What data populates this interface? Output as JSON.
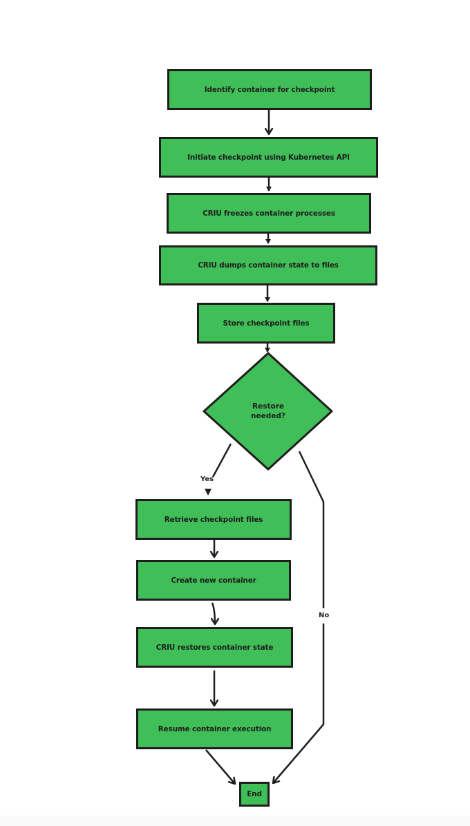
{
  "diagram": {
    "type": "flowchart",
    "fill_color": "#40bf59",
    "stroke_color": "#1e1e1e",
    "nodes": [
      {
        "id": "n1",
        "shape": "rect",
        "label": "Identify container for checkpoint"
      },
      {
        "id": "n2",
        "shape": "rect",
        "label": "Initiate checkpoint using Kubernetes API"
      },
      {
        "id": "n3",
        "shape": "rect",
        "label": "CRIU freezes container processes"
      },
      {
        "id": "n4",
        "shape": "rect",
        "label": "CRIU dumps container state to files"
      },
      {
        "id": "n5",
        "shape": "rect",
        "label": "Store checkpoint files"
      },
      {
        "id": "d1",
        "shape": "diamond",
        "label_line1": "Restore",
        "label_line2": "needed?"
      },
      {
        "id": "n6",
        "shape": "rect",
        "label": "Retrieve checkpoint files"
      },
      {
        "id": "n7",
        "shape": "rect",
        "label": "Create new container"
      },
      {
        "id": "n8",
        "shape": "rect",
        "label": "CRIU restores container state"
      },
      {
        "id": "n9",
        "shape": "rect",
        "label": "Resume container execution"
      },
      {
        "id": "end",
        "shape": "rect",
        "label": "End"
      }
    ],
    "edges": [
      {
        "from": "n1",
        "to": "n2",
        "label": ""
      },
      {
        "from": "n2",
        "to": "n3",
        "label": ""
      },
      {
        "from": "n3",
        "to": "n4",
        "label": ""
      },
      {
        "from": "n4",
        "to": "n5",
        "label": ""
      },
      {
        "from": "n5",
        "to": "d1",
        "label": ""
      },
      {
        "from": "d1",
        "to": "n6",
        "label": "Yes"
      },
      {
        "from": "d1",
        "to": "end",
        "label": "No"
      },
      {
        "from": "n6",
        "to": "n7",
        "label": ""
      },
      {
        "from": "n7",
        "to": "n8",
        "label": ""
      },
      {
        "from": "n8",
        "to": "n9",
        "label": ""
      },
      {
        "from": "n9",
        "to": "end",
        "label": ""
      }
    ]
  }
}
